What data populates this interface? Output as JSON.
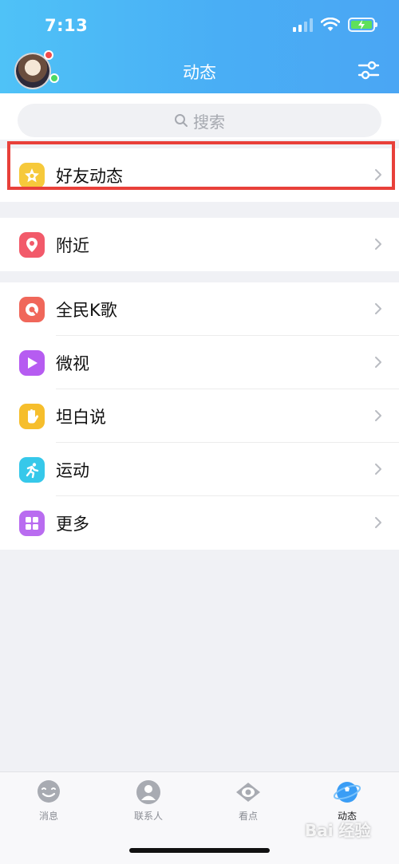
{
  "status": {
    "time": "7:13"
  },
  "header": {
    "title": "动态"
  },
  "search": {
    "placeholder": "搜索"
  },
  "groups": [
    {
      "items": [
        {
          "label": "好友动态",
          "icon": "star-icon",
          "color": "#f6c93b"
        }
      ]
    },
    {
      "items": [
        {
          "label": "附近",
          "icon": "location-pin-icon",
          "color": "#f25a6a"
        }
      ]
    },
    {
      "items": [
        {
          "label": "全民K歌",
          "icon": "karaoke-icon",
          "color": "#f0675a"
        },
        {
          "label": "微视",
          "icon": "play-icon",
          "color": "#b65cf1"
        },
        {
          "label": "坦白说",
          "icon": "hand-icon",
          "color": "#f6be2c"
        },
        {
          "label": "运动",
          "icon": "running-icon",
          "color": "#36c8ea"
        },
        {
          "label": "更多",
          "icon": "grid-icon",
          "color": "#b96cf0"
        }
      ]
    }
  ],
  "tabs": [
    {
      "label": "消息",
      "icon": "message-icon",
      "active": false
    },
    {
      "label": "联系人",
      "icon": "contacts-icon",
      "active": false
    },
    {
      "label": "看点",
      "icon": "eye-icon",
      "active": false
    },
    {
      "label": "动态",
      "icon": "planet-icon",
      "active": true
    }
  ],
  "watermark": "Bai 经验",
  "colors": {
    "header": "#4fb4f6",
    "highlight": "#e8403a",
    "active_tab": "#3a9df5"
  }
}
